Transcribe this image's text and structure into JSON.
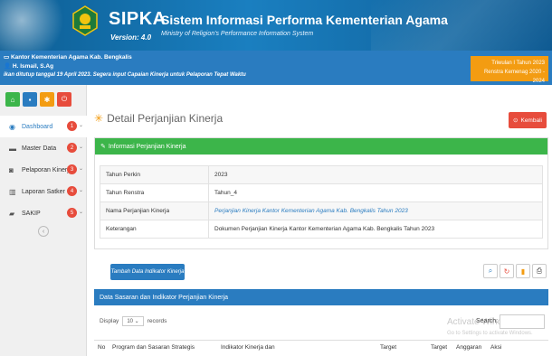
{
  "header": {
    "app_name": "SIPKA",
    "version": "Version: 4.0",
    "title": "Sistem Informasi Performa Kementerian Agama",
    "subtitle": "Ministry of Religion's Performance Information System"
  },
  "infobar": {
    "office": "Kantor Kementerian Agama Kab. Bengkalis",
    "user": "H. Ismail, S.Ag",
    "notice": "ikan ditutup tanggal 19 April 2023. Segera input Capaian Kinerja untuk Pelaporan Tepat Waktu",
    "period_line1": "Triwulan I Tahun 2023",
    "period_line2": "Renstra Kemenag 2020 - 2024"
  },
  "sidebar": {
    "items": [
      {
        "label": "Dashboard",
        "icon": "dashboard-icon",
        "badge": "1"
      },
      {
        "label": "Master Data",
        "icon": "database-icon",
        "badge": "2"
      },
      {
        "label": "Pelaporan Kinerja",
        "icon": "report-icon",
        "badge": "3"
      },
      {
        "label": "Laporan Satker",
        "icon": "bar-chart-icon",
        "badge": "4"
      },
      {
        "label": "SAKIP",
        "icon": "folder-icon",
        "badge": "5"
      }
    ]
  },
  "main": {
    "page_title": "Detail Perjanjian Kinerja",
    "back_label": "Kembali",
    "panel_title": "Informasi Perjanjian Kinerja",
    "info_rows": [
      {
        "key": "Tahun Perkin",
        "value": "2023"
      },
      {
        "key": "Tahun Renstra",
        "value": "Tahun_4"
      },
      {
        "key": "Nama Perjanjian Kinerja",
        "value": "Perjanjian Kinerja Kantor Kementerian Agama Kab. Bengkalis Tahun 2023"
      },
      {
        "key": "Keterangan",
        "value": "Dokumen Perjanjian Kinerja Kantor Kementerian Agama Kab. Bengkalis Tahun 2023"
      }
    ],
    "add_button": "Tambah Data Indikator Kinerja",
    "table_title": "Data Sasaran dan Indikator Perjanjian Kinerja",
    "display_label": "Display",
    "display_value": "10",
    "records_label": "records",
    "search_label": "Search:",
    "watermark_title": "Activate Windows",
    "watermark_sub": "Go to Settings to activate Windows.",
    "columns": [
      "No",
      "Program dan Sasaran Strategis",
      "Indikator Kinerja dan",
      "Target",
      "Target",
      "Anggaran",
      "Aksi"
    ]
  },
  "colors": {
    "primary": "#2a7cc0",
    "success": "#3cb54a",
    "danger": "#e74c3c",
    "warning": "#f39c12"
  }
}
